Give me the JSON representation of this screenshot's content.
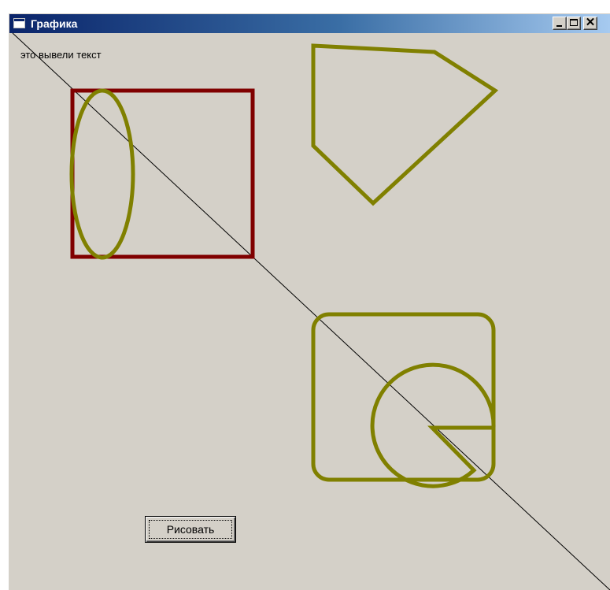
{
  "window": {
    "title": "Графика",
    "controls": {
      "minimize": "minimize",
      "maximize": "maximize",
      "close": "✕"
    }
  },
  "content": {
    "output_text": "это вывели текст",
    "draw_button_label": "Рисовать"
  },
  "colors": {
    "background": "#d4d0c8",
    "rectangle_stroke": "#800000",
    "olive_stroke": "#808000",
    "line": "#000000",
    "titlebar_start": "#0a246a",
    "titlebar_end": "#a6caf0"
  },
  "icons": [
    "window-app-icon",
    "minimize-icon",
    "maximize-icon",
    "close-icon"
  ]
}
